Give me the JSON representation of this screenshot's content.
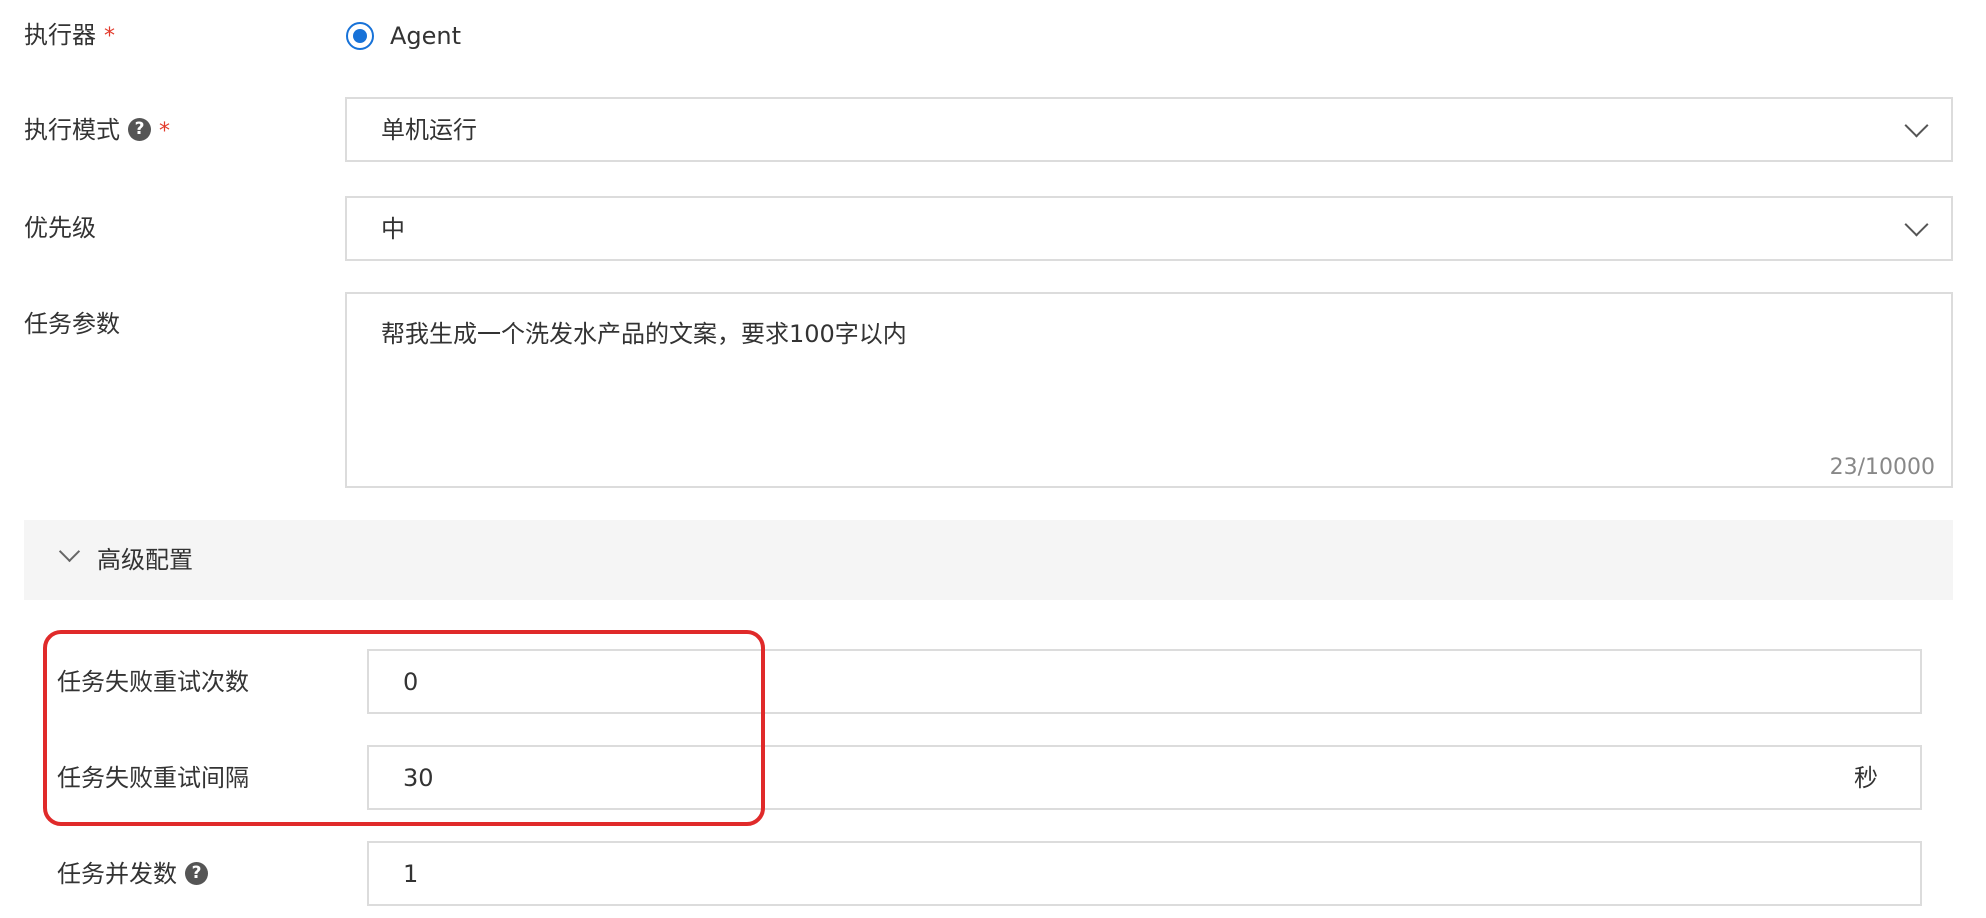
{
  "form": {
    "executor": {
      "label": "执行器",
      "required_mark": "*",
      "option": "Agent",
      "selected": true
    },
    "mode": {
      "label": "执行模式",
      "help": "?",
      "required_mark": "*",
      "value": "单机运行"
    },
    "priority": {
      "label": "优先级",
      "value": "中"
    },
    "params": {
      "label": "任务参数",
      "value": "帮我生成一个洗发水产品的文案，要求100字以内",
      "counter": "23/10000"
    }
  },
  "advanced": {
    "title": "高级配置",
    "retry_count": {
      "label": "任务失败重试次数",
      "value": "0"
    },
    "retry_interval": {
      "label": "任务失败重试间隔",
      "value": "30",
      "unit": "秒"
    },
    "concurrency": {
      "label": "任务并发数",
      "help": "?",
      "value": "1"
    }
  },
  "colors": {
    "accent": "#1772d8",
    "required": "#e23b2c",
    "highlight": "#e02a2a",
    "panel_bg": "#f5f5f5"
  }
}
